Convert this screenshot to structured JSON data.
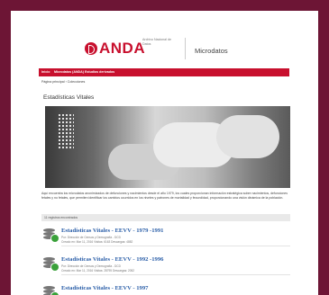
{
  "header": {
    "brand": "ANDA",
    "brand_sub": "Archivo Nacional de Datos",
    "app_title": "Microdatos"
  },
  "nav": {
    "items": [
      "Inicio",
      "Microdatos (ANDA)",
      "Estudios derivados"
    ]
  },
  "breadcrumb": "Página principal › Colecciones",
  "collection": {
    "title": "Estadísticas Vitales",
    "description": "Aquí encuentra los microdatos anonimizados de defunciones y nacimientos desde el año 1979, los cuales proporcionan información estratégica sobre nacimientos, defunciones fetales y no fetales, que permiten identificar los cambios ocurridos en los niveles y patrones de mortalidad y fecundidad, proporcionando una visión dinámica de la población."
  },
  "results": {
    "count_label": "11 registros encontrados",
    "items": [
      {
        "title": "Estadísticas Vitales - EEVV - 1979 -1991",
        "producer": "Por: Dirección de Censos y Demografía - DCD",
        "meta": "Creado en: Mar 11, 2016   Visitas: 6163   Descargas: 4882"
      },
      {
        "title": "Estadísticas Vitales - EEVV - 1992 -1996",
        "producer": "Por: Dirección de Censos y Demografía - DCD",
        "meta": "Creado en: Mar 11, 2016   Visitas: 28795   Descargas: 2052"
      },
      {
        "title": "Estadísticas Vitales - EEVV - 1997",
        "producer": "",
        "meta": ""
      }
    ]
  },
  "colors": {
    "accent": "#c8102e",
    "frame": "#6d1535",
    "link": "#2a5ea8",
    "status": "#3aa13a"
  },
  "icons": [
    "database-icon",
    "download-badge-icon"
  ]
}
